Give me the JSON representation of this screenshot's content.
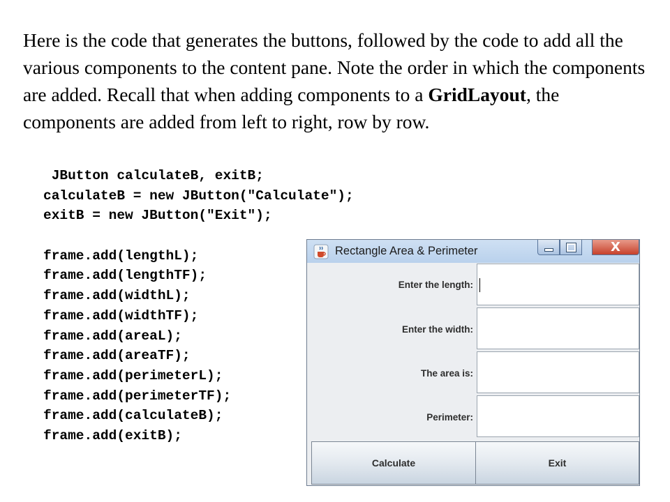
{
  "paragraph": {
    "part1": "Here is the code that generates the buttons, followed by the code to add all the various components to the content pane.  Note the order in which the components are added.  Recall that when adding components to a ",
    "bold": "GridLayout",
    "part2": ", the components are added from left to right, row by row."
  },
  "code_lines": [
    " JButton calculateB, exitB;",
    "calculateB = new JButton(\"Calculate\");",
    "exitB = new JButton(\"Exit\");",
    "",
    "frame.add(lengthL);",
    "frame.add(lengthTF);",
    "frame.add(widthL);",
    "frame.add(widthTF);",
    "frame.add(areaL);",
    "frame.add(areaTF);",
    "frame.add(perimeterL);",
    "frame.add(perimeterTF);",
    "frame.add(calculateB);",
    "frame.add(exitB);"
  ],
  "window": {
    "title": "Rectangle Area & Perimeter",
    "icon": "java-cup-icon",
    "close_glyph": "X",
    "labels": {
      "length": "Enter the length:",
      "width": "Enter the width:",
      "area": "The area is:",
      "perimeter": "Perimeter:"
    },
    "fields": {
      "length": "",
      "width": "",
      "area": "",
      "perimeter": ""
    },
    "buttons": {
      "calculate": "Calculate",
      "exit": "Exit"
    }
  }
}
